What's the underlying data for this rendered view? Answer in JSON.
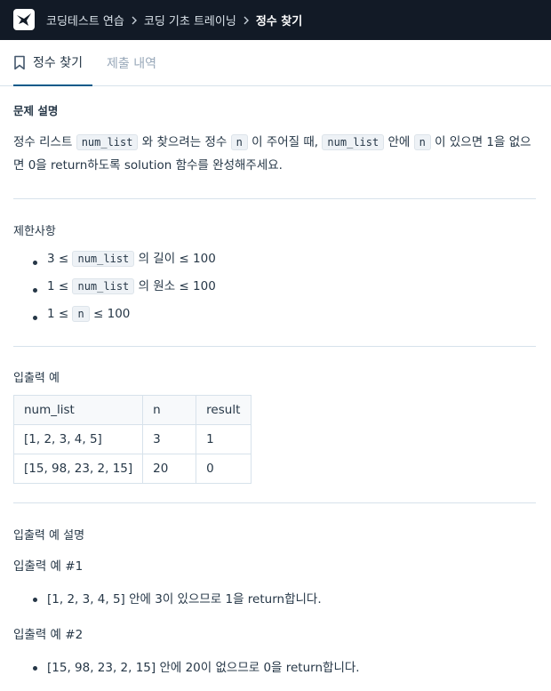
{
  "breadcrumb": [
    "코딩테스트 연습",
    "코딩 기초 트레이닝",
    "정수 찾기"
  ],
  "tabs": {
    "active": "정수 찾기",
    "inactive": "제출 내역"
  },
  "problem": {
    "heading": "문제 설명",
    "desc": {
      "t1": "정수 리스트 ",
      "c1": "num_list",
      "t2": " 와 찾으려는 정수 ",
      "c2": "n",
      "t3": " 이 주어질 때, ",
      "c3": "num_list",
      "t4": " 안에 ",
      "c4": "n",
      "t5": " 이 있으면 1을 없으면 0을 return하도록 solution 함수를 완성해주세요."
    }
  },
  "constraints": {
    "heading": "제한사항",
    "items": [
      {
        "pre": "3 ≤ ",
        "code": "num_list",
        "post": " 의 길이 ≤ 100"
      },
      {
        "pre": "1 ≤ ",
        "code": "num_list",
        "post": " 의 원소 ≤ 100"
      },
      {
        "pre": "1 ≤ ",
        "code": "n",
        "post": " ≤ 100"
      }
    ]
  },
  "examples": {
    "heading": "입출력 예",
    "headers": [
      "num_list",
      "n",
      "result"
    ],
    "rows": [
      [
        "[1, 2, 3, 4, 5]",
        "3",
        "1"
      ],
      [
        "[15, 98, 23, 2, 15]",
        "20",
        "0"
      ]
    ]
  },
  "explanation": {
    "heading": "입출력 예 설명",
    "ex1_title": "입출력 예 #1",
    "ex1_text": "[1, 2, 3, 4, 5] 안에 3이 있으므로 1을 return합니다.",
    "ex2_title": "입출력 예 #2",
    "ex2_text": "[15, 98, 23, 2, 15] 안에 20이 없으므로 0을 return합니다."
  }
}
